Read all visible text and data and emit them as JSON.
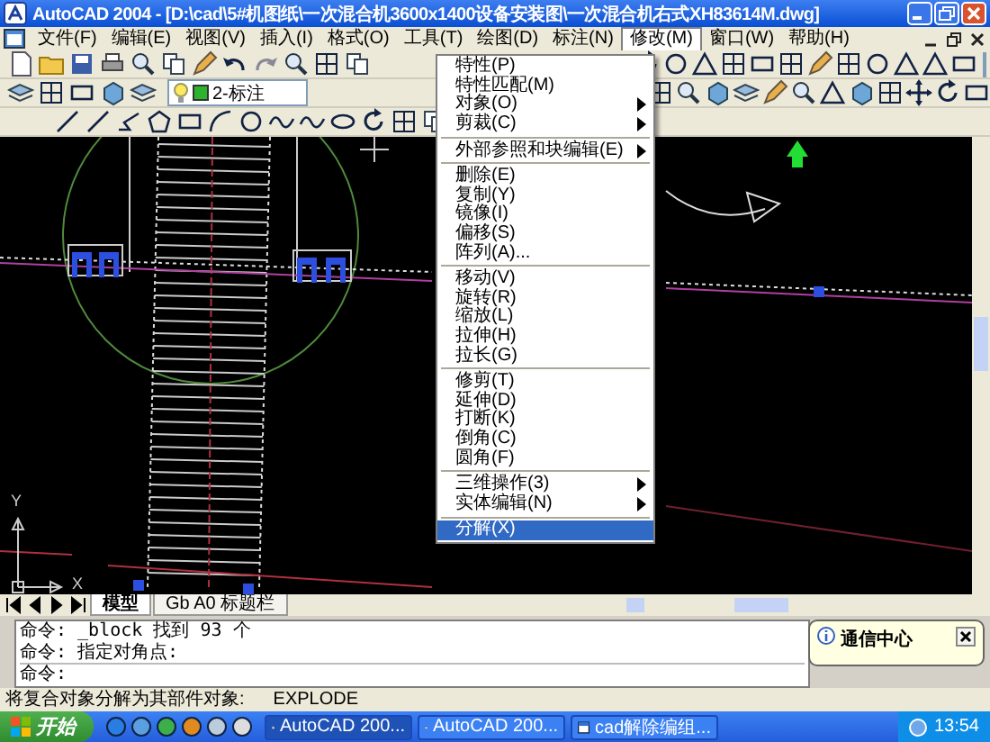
{
  "window": {
    "title": "AutoCAD 2004 - [D:\\cad\\5#机图纸\\一次混合机3600x1400设备安装图\\一次混合机右式XH83614M.dwg]"
  },
  "menu_bar": [
    {
      "label": "文件(F)",
      "selected": false
    },
    {
      "label": "编辑(E)",
      "selected": false
    },
    {
      "label": "视图(V)",
      "selected": false
    },
    {
      "label": "插入(I)",
      "selected": false
    },
    {
      "label": "格式(O)",
      "selected": false
    },
    {
      "label": "工具(T)",
      "selected": false
    },
    {
      "label": "绘图(D)",
      "selected": false
    },
    {
      "label": "标注(N)",
      "selected": false
    },
    {
      "label": "修改(M)",
      "selected": true
    },
    {
      "label": "窗口(W)",
      "selected": false
    },
    {
      "label": "帮助(H)",
      "selected": false
    }
  ],
  "modify_menu": {
    "items": [
      {
        "kind": "item",
        "label": "特性(P)",
        "submenu": false,
        "selected": false
      },
      {
        "kind": "item",
        "label": "特性匹配(M)",
        "submenu": false,
        "selected": false
      },
      {
        "kind": "item",
        "label": "对象(O)",
        "submenu": true,
        "selected": false
      },
      {
        "kind": "item",
        "label": "剪裁(C)",
        "submenu": true,
        "selected": false
      },
      {
        "kind": "separator"
      },
      {
        "kind": "item",
        "label": "外部参照和块编辑(E)",
        "submenu": true,
        "selected": false
      },
      {
        "kind": "separator"
      },
      {
        "kind": "item",
        "label": "删除(E)",
        "submenu": false,
        "selected": false
      },
      {
        "kind": "item",
        "label": "复制(Y)",
        "submenu": false,
        "selected": false
      },
      {
        "kind": "item",
        "label": "镜像(I)",
        "submenu": false,
        "selected": false
      },
      {
        "kind": "item",
        "label": "偏移(S)",
        "submenu": false,
        "selected": false
      },
      {
        "kind": "item",
        "label": "阵列(A)...",
        "submenu": false,
        "selected": false
      },
      {
        "kind": "separator"
      },
      {
        "kind": "item",
        "label": "移动(V)",
        "submenu": false,
        "selected": false
      },
      {
        "kind": "item",
        "label": "旋转(R)",
        "submenu": false,
        "selected": false
      },
      {
        "kind": "item",
        "label": "缩放(L)",
        "submenu": false,
        "selected": false
      },
      {
        "kind": "item",
        "label": "拉伸(H)",
        "submenu": false,
        "selected": false
      },
      {
        "kind": "item",
        "label": "拉长(G)",
        "submenu": false,
        "selected": false
      },
      {
        "kind": "separator"
      },
      {
        "kind": "item",
        "label": "修剪(T)",
        "submenu": false,
        "selected": false
      },
      {
        "kind": "item",
        "label": "延伸(D)",
        "submenu": false,
        "selected": false
      },
      {
        "kind": "item",
        "label": "打断(K)",
        "submenu": false,
        "selected": false
      },
      {
        "kind": "item",
        "label": "倒角(C)",
        "submenu": false,
        "selected": false
      },
      {
        "kind": "item",
        "label": "圆角(F)",
        "submenu": false,
        "selected": false
      },
      {
        "kind": "separator"
      },
      {
        "kind": "item",
        "label": "三维操作(3)",
        "submenu": true,
        "selected": false
      },
      {
        "kind": "item",
        "label": "实体编辑(N)",
        "submenu": true,
        "selected": false
      },
      {
        "kind": "separator"
      },
      {
        "kind": "item",
        "label": "分解(X)",
        "submenu": false,
        "selected": true
      }
    ]
  },
  "layer_control": {
    "value": "2-标注"
  },
  "ucs_icon": {
    "x_label": "X",
    "y_label": "Y"
  },
  "layout_tabs": [
    {
      "label": "模型",
      "selected": true
    },
    {
      "label": "Gb A0 标题栏",
      "selected": false
    }
  ],
  "command_history": [
    "命令: _block 找到 93 个",
    "命令: 指定对角点:"
  ],
  "command_prompt": "命令:",
  "status_bar": [
    "将复合对象分解为其部件对象:",
    "EXPLODE"
  ],
  "notification": {
    "title": "通信中心"
  },
  "taskbar": {
    "start": "开始",
    "tasks": [
      {
        "label": "AutoCAD 200...",
        "selected": true
      },
      {
        "label": "AutoCAD 200...",
        "selected": false
      },
      {
        "label": "cad解除编组...",
        "selected": false
      }
    ],
    "clock": "13:54"
  }
}
